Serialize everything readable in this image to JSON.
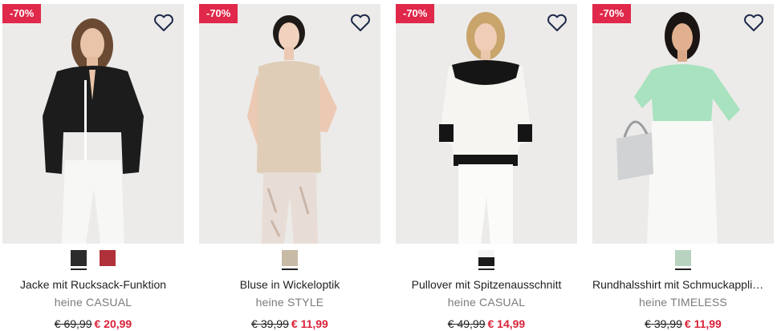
{
  "colors": {
    "badge": "#e0284a",
    "sale_price": "#d9223a",
    "brand_text": "#7b7b7b"
  },
  "products": [
    {
      "badge": "-70%",
      "wishlist_icon": "heart-outline-icon",
      "swatches": [
        {
          "color": "#2b2b2b",
          "selected": true
        },
        {
          "color": "#b0303a",
          "selected": false
        }
      ],
      "title": "Jacke mit Rucksack-Funktion",
      "brand": "heine CASUAL",
      "old_price": "€ 69,99",
      "new_price": "€ 20,99"
    },
    {
      "badge": "-70%",
      "wishlist_icon": "heart-outline-icon",
      "swatches": [
        {
          "color": "#c8bba6",
          "selected": true
        }
      ],
      "title": "Bluse in Wickeloptik",
      "brand": "heine STYLE",
      "old_price": "€ 39,99",
      "new_price": "€ 11,99"
    },
    {
      "badge": "-70%",
      "wishlist_icon": "heart-outline-icon",
      "swatches": [
        {
          "color": "bw",
          "selected": true
        }
      ],
      "title": "Pullover mit Spitzenausschnitt",
      "brand": "heine CASUAL",
      "old_price": "€ 49,99",
      "new_price": "€ 14,99"
    },
    {
      "badge": "-70%",
      "wishlist_icon": "heart-outline-icon",
      "swatches": [
        {
          "color": "#b8d4c0",
          "selected": true
        }
      ],
      "title": "Rundhalsshirt mit Schmuckappli…",
      "brand": "heine TIMELESS",
      "old_price": "€ 39,99",
      "new_price": "€ 11,99"
    }
  ]
}
